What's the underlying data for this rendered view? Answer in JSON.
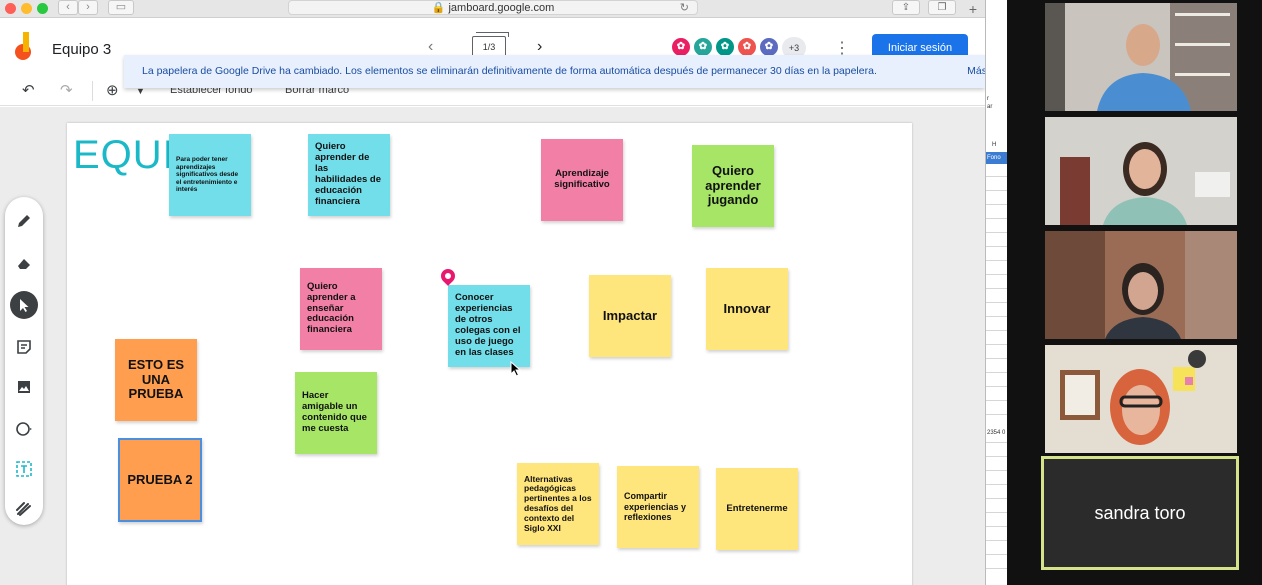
{
  "browser": {
    "url": "jamboard.google.com"
  },
  "jamboard": {
    "title": "Equipo 3",
    "frame_indicator": "1/3",
    "extra_collaborators": "+3",
    "signin_label": "Iniciar sesión",
    "banner_text": "La papelera de Google Drive ha cambiado. Los elementos se eliminarán definitivamente de forma automática después de permanecer 30 días en la papelera.",
    "banner_more": "Más",
    "toolbar": {
      "set_background": "Establecer fondo",
      "clear_frame": "Borrar marco"
    },
    "board_title": "EQUII",
    "notes": [
      {
        "text": "Para poder tener aprendizajes significativos desde el entretenimiento e interés",
        "color": "#72deea"
      },
      {
        "text": "Quiero aprender de las habilidades de educación financiera",
        "color": "#72deea"
      },
      {
        "text": "Aprendizaje significativo",
        "color": "#f27fa6"
      },
      {
        "text": "Quiero aprender jugando",
        "color": "#a6e566"
      },
      {
        "text": "Quiero aprender a enseñar educación financiera",
        "color": "#f27fa6"
      },
      {
        "text": "Conocer experiencias de otros colegas con el uso de juego en las clases",
        "color": "#72deea"
      },
      {
        "text": "Impactar",
        "color": "#fee57c"
      },
      {
        "text": "Innovar",
        "color": "#fee57c"
      },
      {
        "text": "ESTO ES UNA PRUEBA",
        "color": "#ff9e4e"
      },
      {
        "text": "Hacer amigable un contenido que me cuesta",
        "color": "#a6e566"
      },
      {
        "text": "PRUEBA 2",
        "color": "#ff9e4e"
      },
      {
        "text": "Alternativas pedagógicas pertinentes a los desafíos del contexto del Siglo XXI",
        "color": "#fee57c"
      },
      {
        "text": "Compartir experiencias y reflexiones",
        "color": "#fee57c"
      },
      {
        "text": "Entretenerme",
        "color": "#fee57c"
      }
    ],
    "tools": [
      "pen-icon",
      "eraser-icon",
      "select-icon",
      "sticky-note-icon",
      "image-icon",
      "circle-icon",
      "text-box-icon",
      "laser-icon"
    ]
  },
  "sheet": {
    "header_text": "Fono",
    "side_text_1": "r",
    "side_text_2": "ar",
    "col_letter": "H",
    "cell_value": "2354 0"
  },
  "meeting": {
    "participant_name": "sandra toro"
  }
}
